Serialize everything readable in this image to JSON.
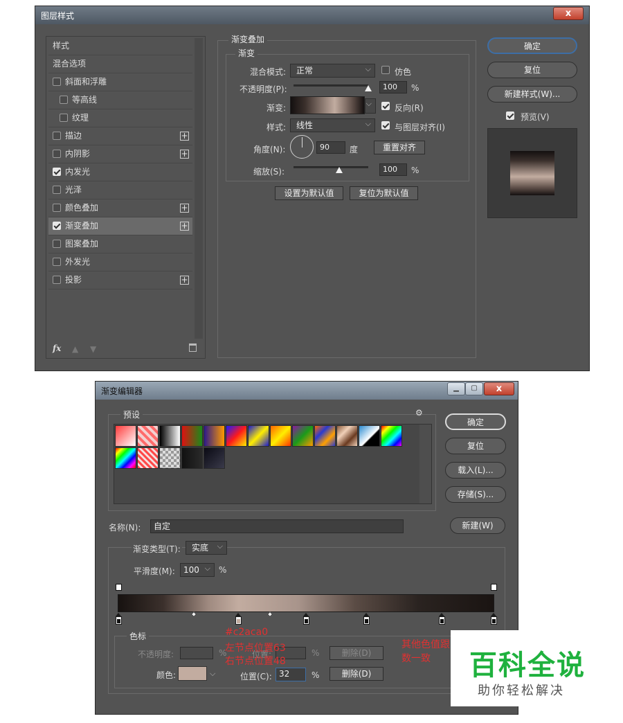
{
  "layer_style": {
    "title": "图层样式",
    "close_label": "x",
    "styles_header": "样式",
    "blend_options": "混合选项",
    "items": [
      {
        "label": "斜面和浮雕",
        "checked": false,
        "indent": false,
        "plus": false
      },
      {
        "label": "等高线",
        "checked": false,
        "indent": true,
        "plus": false
      },
      {
        "label": "纹理",
        "checked": false,
        "indent": true,
        "plus": false
      },
      {
        "label": "描边",
        "checked": false,
        "indent": false,
        "plus": true
      },
      {
        "label": "内阴影",
        "checked": false,
        "indent": false,
        "plus": true
      },
      {
        "label": "内发光",
        "checked": true,
        "indent": false,
        "plus": false
      },
      {
        "label": "光泽",
        "checked": false,
        "indent": false,
        "plus": false
      },
      {
        "label": "颜色叠加",
        "checked": false,
        "indent": false,
        "plus": true
      },
      {
        "label": "渐变叠加",
        "checked": true,
        "indent": false,
        "plus": true,
        "selected": true
      },
      {
        "label": "图案叠加",
        "checked": false,
        "indent": false,
        "plus": false
      },
      {
        "label": "外发光",
        "checked": false,
        "indent": false,
        "plus": false
      },
      {
        "label": "投影",
        "checked": false,
        "indent": false,
        "plus": true
      }
    ],
    "fx_label": "fx",
    "gradient_overlay": {
      "section_title": "渐变叠加",
      "sub_title": "渐变",
      "blend_mode_label": "混合模式:",
      "blend_mode_value": "正常",
      "dither_label": "仿色",
      "opacity_label": "不透明度(P):",
      "opacity_value": "100",
      "opacity_unit": "%",
      "gradient_label": "渐变:",
      "reverse_label": "反向(R)",
      "style_label": "样式:",
      "style_value": "线性",
      "align_label": "与图层对齐(I)",
      "angle_label": "角度(N):",
      "angle_value": "90",
      "angle_unit": "度",
      "reset_align_label": "重置对齐",
      "scale_label": "缩放(S):",
      "scale_value": "100",
      "scale_unit": "%",
      "make_default_label": "设置为默认值",
      "reset_default_label": "复位为默认值"
    },
    "buttons": {
      "ok": "确定",
      "reset": "复位",
      "new_style": "新建样式(W)...",
      "preview": "预览(V)"
    }
  },
  "gradient_editor": {
    "title": "渐变编辑器",
    "presets_label": "预设",
    "buttons": {
      "ok": "确定",
      "reset": "复位",
      "load": "载入(L)...",
      "save": "存储(S)...",
      "new": "新建(W)"
    },
    "name_label": "名称(N):",
    "name_value": "自定",
    "type_label": "渐变类型(T):",
    "type_value": "实底",
    "smooth_label": "平滑度(M):",
    "smooth_value": "100",
    "smooth_unit": "%",
    "stops_group": "色标",
    "opacity_label": "不透明度:",
    "opacity_unit": "%",
    "position_label_dim": "位置:",
    "delete_label_dim": "删除(D)",
    "color_label": "颜色:",
    "position_label": "位置(C):",
    "position_value": "32",
    "position_unit": "%",
    "delete_label": "删除(D)"
  },
  "annotations": {
    "color_hex": "#c2aca0",
    "left_node": "左节点位置63",
    "right_node": "右节点位置48",
    "other": "其他色值跟",
    "other2": "数一致"
  },
  "watermark": {
    "big": "百科全说",
    "small": "助你轻松解决"
  },
  "colors": {
    "accent_blue": "#3d6ea6",
    "selected_stop_color": "#c2aca0",
    "annotation_red": "#e03131",
    "watermark_green": "#1fb13e"
  }
}
